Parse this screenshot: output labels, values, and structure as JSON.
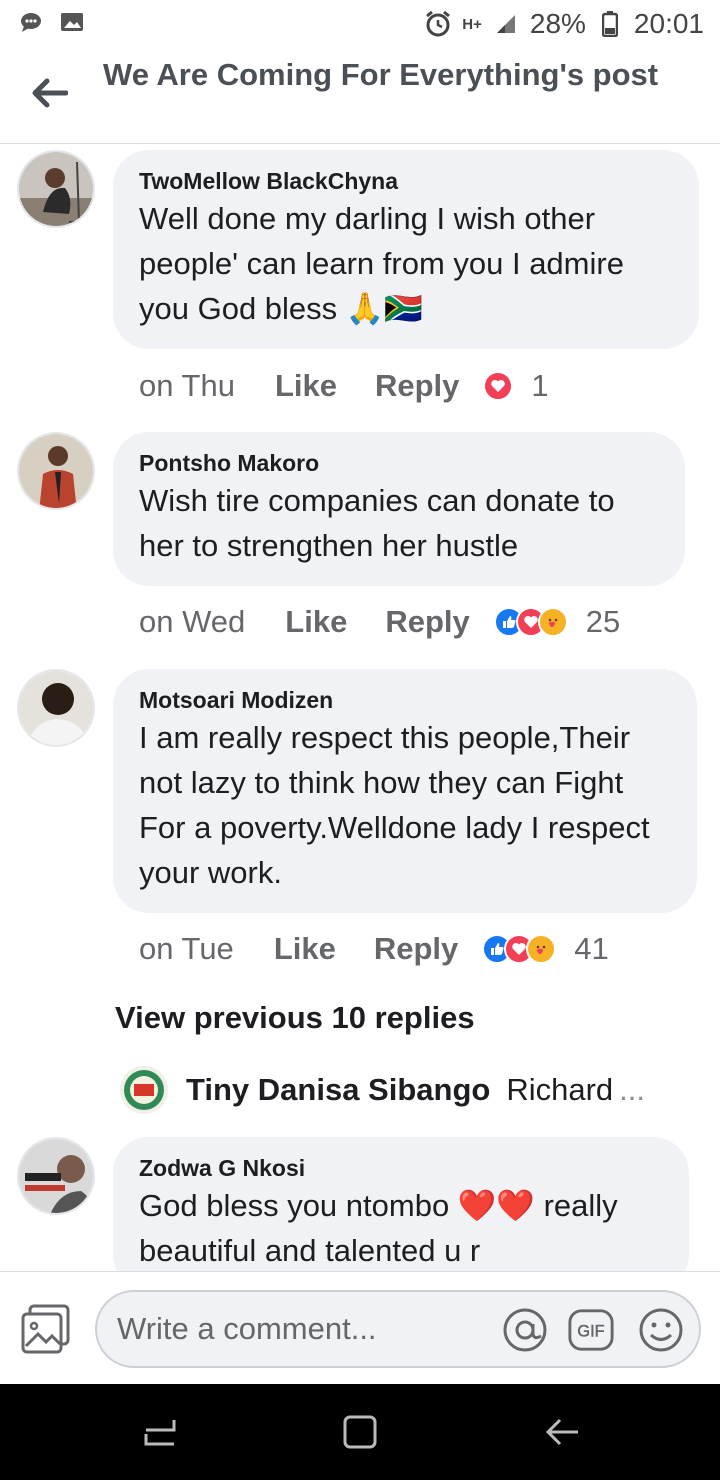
{
  "status_bar": {
    "battery": "28%",
    "time": "20:01",
    "network": "H+",
    "icons": [
      "chat-bubble-icon",
      "image-icon",
      "alarm-icon",
      "signal-icon",
      "battery-icon"
    ]
  },
  "header": {
    "title": "We Are Coming For Everything's post",
    "back_icon": "arrow-left-icon"
  },
  "comments": [
    {
      "author": "TwoMellow BlackChyna",
      "text": "Well done my darling I wish other people' can learn from you I  admire you God bless 🙏🇿🇦",
      "time": "on Thu",
      "like_label": "Like",
      "reply_label": "Reply",
      "reactions": [
        "love"
      ],
      "count": "1"
    },
    {
      "author": "Pontsho Makoro",
      "text": "Wish tire companies can donate to her to strengthen her hustle",
      "time": "on Wed",
      "like_label": "Like",
      "reply_label": "Reply",
      "reactions": [
        "like",
        "love",
        "care"
      ],
      "count": "25"
    },
    {
      "author": "Motsoari Modizen",
      "text": "I am really respect this people,Their not lazy to think how they can Fight For a poverty.Welldone lady I respect your work.",
      "time": "on Tue",
      "like_label": "Like",
      "reply_label": "Reply",
      "reactions": [
        "like",
        "love",
        "care"
      ],
      "count": "41"
    }
  ],
  "view_previous": "View previous 10 replies",
  "latest_reply": {
    "author": "Tiny Danisa Sibango",
    "text": "Richard",
    "ellipsis": "..."
  },
  "last_comment": {
    "author": "Zodwa G Nkosi",
    "text": "God bless you ntombo ❤️❤️ really beautiful and talented u r"
  },
  "composer": {
    "placeholder": "Write a comment...",
    "icons": [
      "photo-icon",
      "mention-icon",
      "gif-icon",
      "emoji-icon"
    ]
  },
  "navbar": {
    "icons": [
      "recents-icon",
      "home-icon",
      "back-icon"
    ]
  },
  "colors": {
    "bubble": "#f0f2f5",
    "like_blue": "#1877f2",
    "love_red": "#f33e58",
    "care_yellow": "#f7b125",
    "meta_grey": "#65676b"
  }
}
